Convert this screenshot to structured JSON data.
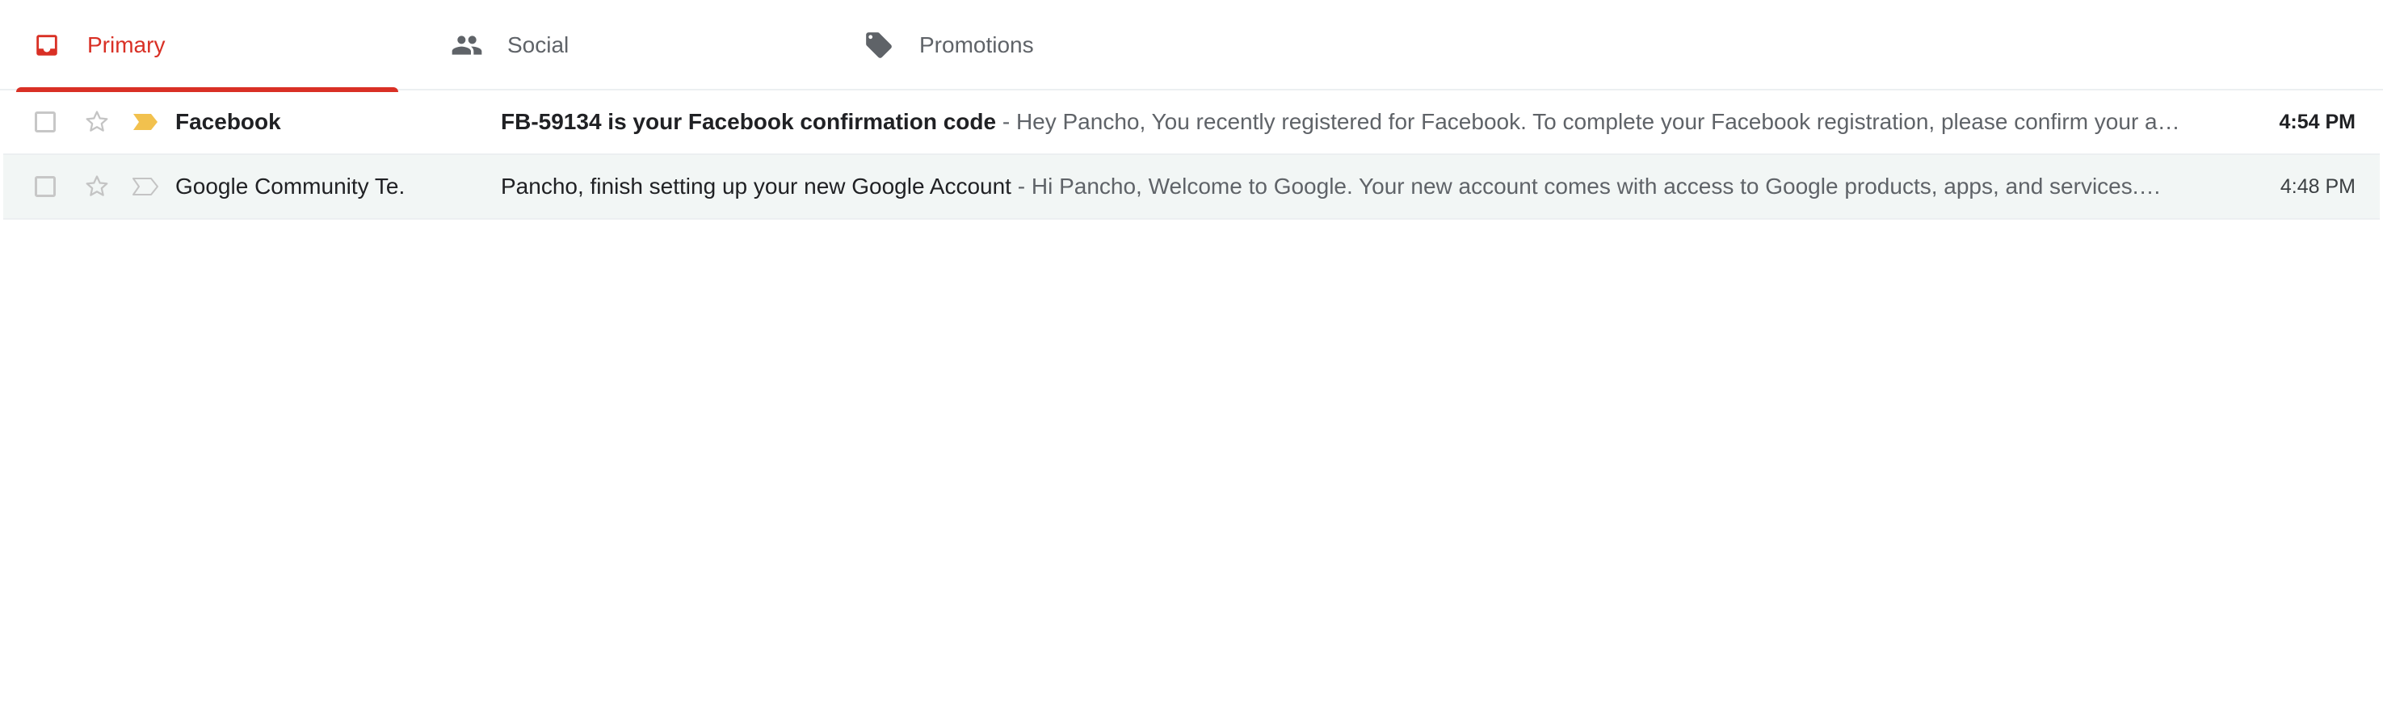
{
  "tabs": [
    {
      "label": "Primary",
      "icon": "inbox-icon",
      "active": true
    },
    {
      "label": "Social",
      "icon": "people-icon",
      "active": false
    },
    {
      "label": "Promotions",
      "icon": "tag-icon",
      "active": false
    }
  ],
  "colors": {
    "accent": "#d93025",
    "important_marker": "#f2c14e",
    "read_row_bg": "#f2f6f5"
  },
  "emails": [
    {
      "sender": "Facebook",
      "subject": "FB-59134 is your Facebook confirmation code",
      "separator": " - ",
      "snippet": "Hey Pancho, You recently registered for Facebook. To complete your Facebook registration, please confirm your a…",
      "time": "4:54 PM",
      "unread": true,
      "important": true,
      "starred": false
    },
    {
      "sender": "Google Community Te.",
      "subject": "Pancho, finish setting up your new Google Account",
      "separator": " - ",
      "snippet": "Hi Pancho, Welcome to Google. Your new account comes with access to Google products, apps, and services.…",
      "time": "4:48 PM",
      "unread": false,
      "important": false,
      "starred": false
    }
  ]
}
